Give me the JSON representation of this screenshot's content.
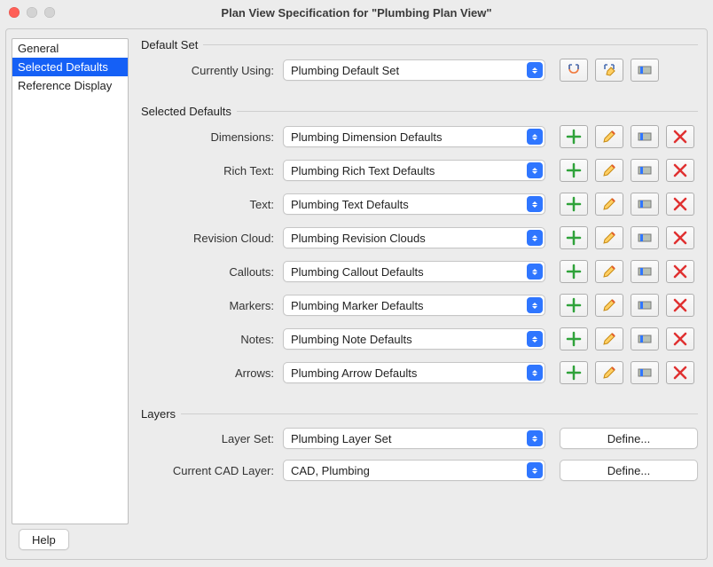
{
  "window": {
    "title": "Plan View Specification for \"Plumbing Plan View\""
  },
  "sidebar": {
    "items": [
      {
        "label": "General"
      },
      {
        "label": "Selected Defaults"
      },
      {
        "label": "Reference Display"
      }
    ],
    "selected_index": 1
  },
  "sections": {
    "default_set": {
      "legend": "Default Set",
      "currently_using_label": "Currently Using:",
      "currently_using_value": "Plumbing Default Set"
    },
    "selected_defaults": {
      "legend": "Selected Defaults",
      "rows": [
        {
          "label": "Dimensions:",
          "value": "Plumbing Dimension Defaults"
        },
        {
          "label": "Rich Text:",
          "value": "Plumbing Rich Text Defaults"
        },
        {
          "label": "Text:",
          "value": "Plumbing Text Defaults"
        },
        {
          "label": "Revision Cloud:",
          "value": "Plumbing Revision Clouds"
        },
        {
          "label": "Callouts:",
          "value": "Plumbing Callout Defaults"
        },
        {
          "label": "Markers:",
          "value": "Plumbing Marker Defaults"
        },
        {
          "label": "Notes:",
          "value": "Plumbing Note Defaults"
        },
        {
          "label": "Arrows:",
          "value": "Plumbing Arrow Defaults"
        }
      ]
    },
    "layers": {
      "legend": "Layers",
      "layer_set_label": "Layer Set:",
      "layer_set_value": "Plumbing Layer Set",
      "cad_layer_label": "Current CAD Layer:",
      "cad_layer_value": "CAD, Plumbing",
      "define_label": "Define..."
    }
  },
  "footer": {
    "help_label": "Help"
  }
}
